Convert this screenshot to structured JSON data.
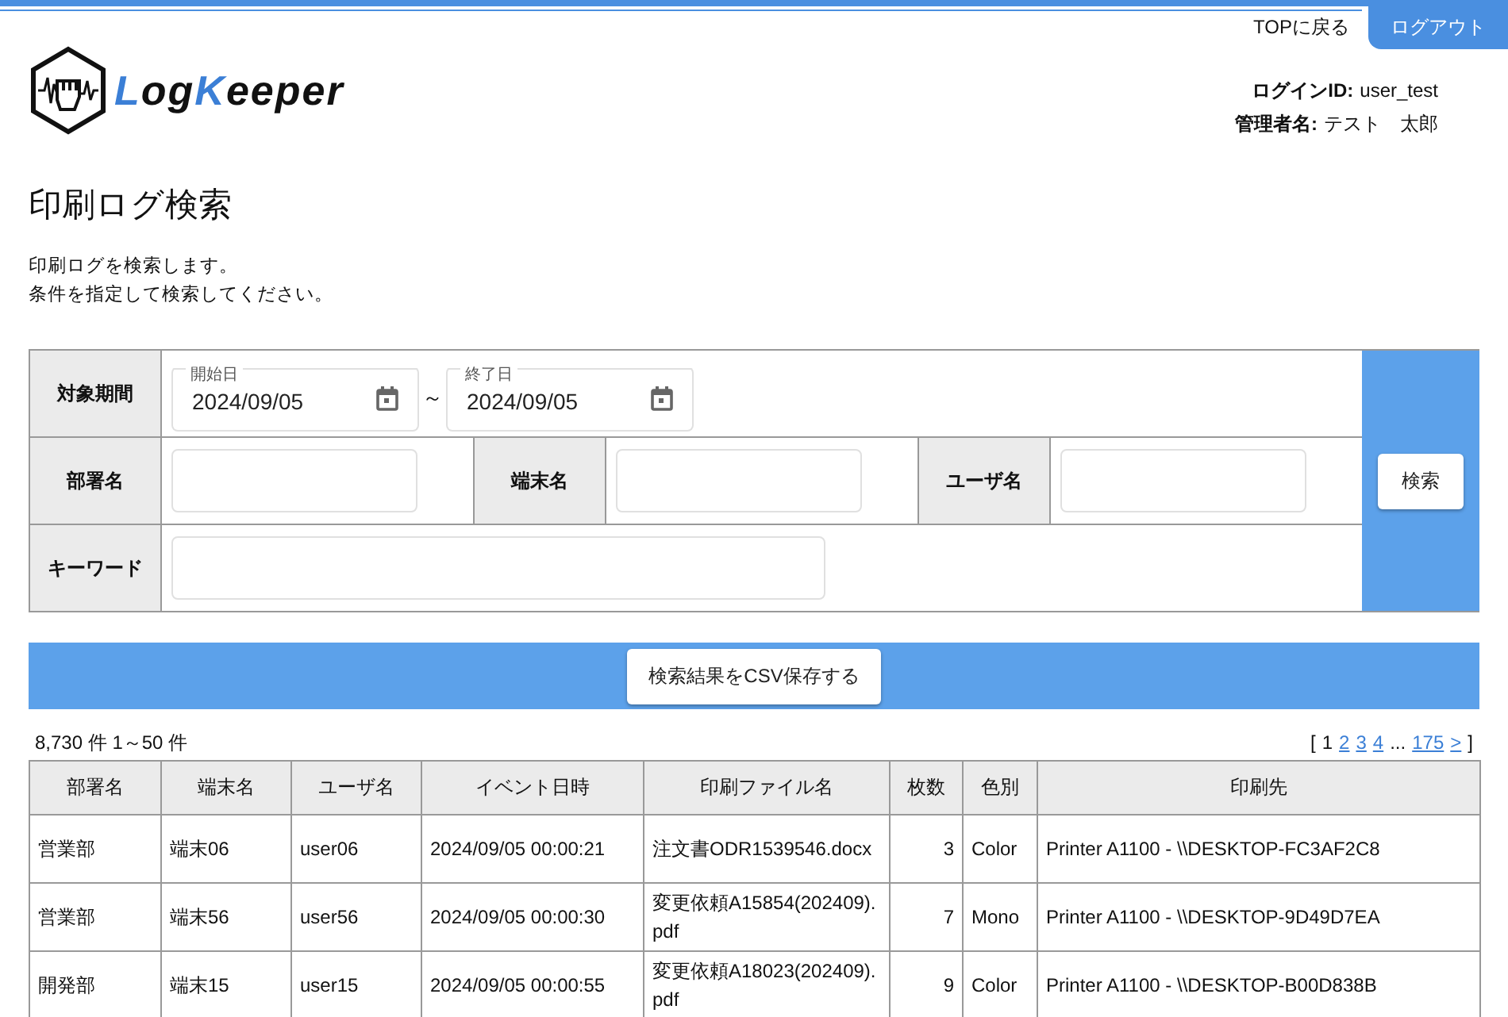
{
  "top_nav": {
    "top_link": "TOPに戻る",
    "logout_button": "ログアウト"
  },
  "logo": {
    "parts": [
      {
        "text": "L",
        "accent": true
      },
      {
        "text": "og",
        "accent": false
      },
      {
        "text": "K",
        "accent": true
      },
      {
        "text": "eeper",
        "accent": false
      }
    ]
  },
  "user_info": [
    {
      "label": "ログインID:",
      "value": "user_test"
    },
    {
      "label": "管理者名:",
      "value": "テスト　太郎"
    }
  ],
  "page_title": "印刷ログ検索",
  "description": [
    "印刷ログを検索します。",
    "条件を指定して検索してください。"
  ],
  "search_form": {
    "period": {
      "label": "対象期間",
      "start": {
        "label": "開始日",
        "value": "2024/09/05"
      },
      "separator": "～",
      "end": {
        "label": "終了日",
        "value": "2024/09/05"
      }
    },
    "department": {
      "label": "部署名"
    },
    "terminal": {
      "label": "端末名"
    },
    "user": {
      "label": "ユーザ名"
    },
    "keyword": {
      "label": "キーワード"
    },
    "search_button": "検索"
  },
  "csv_button": "検索結果をCSV保存する",
  "result_count": "8,730 件 1～50 件",
  "pagination": [
    {
      "text": "[",
      "kind": "bracket"
    },
    {
      "text": "1",
      "kind": "current"
    },
    {
      "text": "2",
      "kind": "link"
    },
    {
      "text": "3",
      "kind": "link"
    },
    {
      "text": "4",
      "kind": "link"
    },
    {
      "text": "...",
      "kind": "text"
    },
    {
      "text": "175",
      "kind": "link"
    },
    {
      "text": ">",
      "kind": "link"
    },
    {
      "text": "]",
      "kind": "bracket"
    }
  ],
  "table": {
    "columns": [
      "部署名",
      "端末名",
      "ユーザ名",
      "イベント日時",
      "印刷ファイル名",
      "枚数",
      "色別",
      "印刷先"
    ],
    "rows": [
      [
        "営業部",
        "端末06",
        "user06",
        "2024/09/05 00:00:21",
        "注文書ODR1539546.docx",
        "3",
        "Color",
        "Printer A1100 - \\\\DESKTOP-FC3AF2C8"
      ],
      [
        "営業部",
        "端末56",
        "user56",
        "2024/09/05 00:00:30",
        "変更依頼A15854(202409).pdf",
        "7",
        "Mono",
        "Printer A1100 - \\\\DESKTOP-9D49D7EA"
      ],
      [
        "開発部",
        "端末15",
        "user15",
        "2024/09/05 00:00:55",
        "変更依頼A18023(202409).pdf",
        "9",
        "Color",
        "Printer A1100 - \\\\DESKTOP-B00D838B"
      ]
    ]
  }
}
